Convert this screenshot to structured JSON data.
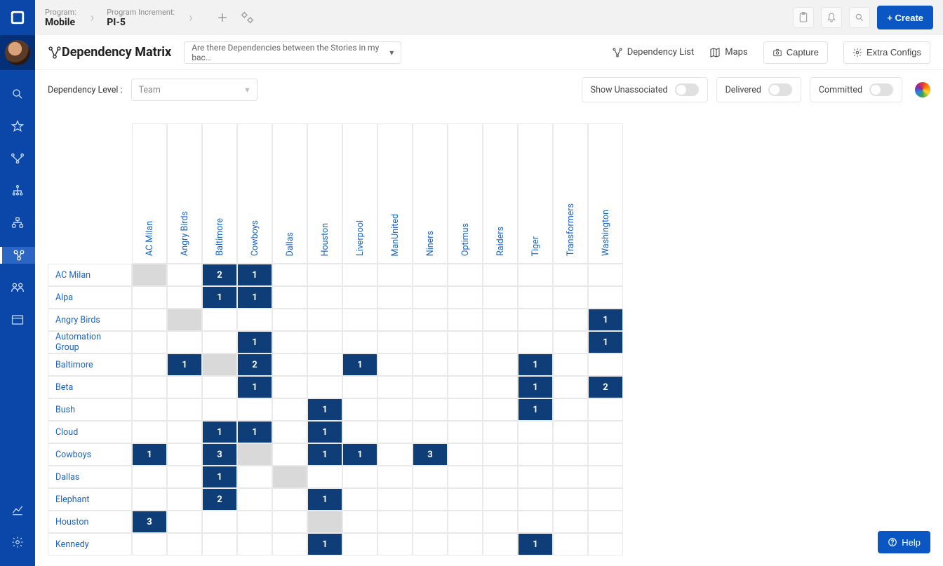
{
  "breadcrumb": {
    "program_label": "Program:",
    "program_value": "Mobile",
    "pi_label": "Program Increment:",
    "pi_value": "PI-5"
  },
  "topbar": {
    "create_label": "+ Create"
  },
  "page": {
    "title": "Dependency Matrix",
    "filter_label": "Are there Dependencies between the Stories in my bac…"
  },
  "views": {
    "dep_list": "Dependency List",
    "maps": "Maps",
    "capture": "Capture",
    "extra_configs": "Extra Configs"
  },
  "toolbar": {
    "level_label": "Dependency Level :",
    "level_value": "Team",
    "show_unassociated": "Show Unassociated",
    "delivered": "Delivered",
    "committed": "Committed"
  },
  "help": {
    "label": "Help"
  },
  "matrix": {
    "cols": [
      "AC Milan",
      "Angry Birds",
      "Baltimore",
      "Cowboys",
      "Dallas",
      "Houston",
      "Liverpool",
      "ManUnited",
      "Niners",
      "Optimus",
      "Raiders",
      "Tiger",
      "Transformers",
      "Washington"
    ],
    "rows": [
      {
        "name": "AC Milan",
        "diag": 0,
        "cells": {
          "2": 2,
          "3": 1
        }
      },
      {
        "name": "Alpa",
        "diag": -1,
        "cells": {
          "2": 1,
          "3": 1
        }
      },
      {
        "name": "Angry Birds",
        "diag": 1,
        "cells": {
          "13": 1
        }
      },
      {
        "name": "Automation Group",
        "diag": -1,
        "cells": {
          "3": 1,
          "13": 1
        }
      },
      {
        "name": "Baltimore",
        "diag": 2,
        "cells": {
          "1": 1,
          "3": 2,
          "6": 1,
          "11": 1
        }
      },
      {
        "name": "Beta",
        "diag": -1,
        "cells": {
          "3": 1,
          "11": 1,
          "13": 2
        }
      },
      {
        "name": "Bush",
        "diag": -1,
        "cells": {
          "5": 1,
          "11": 1
        }
      },
      {
        "name": "Cloud",
        "diag": -1,
        "cells": {
          "2": 1,
          "3": 1,
          "5": 1
        }
      },
      {
        "name": "Cowboys",
        "diag": 3,
        "cells": {
          "0": 1,
          "2": 3,
          "5": 1,
          "6": 1,
          "8": 3
        }
      },
      {
        "name": "Dallas",
        "diag": 4,
        "cells": {
          "2": 1
        }
      },
      {
        "name": "Elephant",
        "diag": -1,
        "cells": {
          "2": 2,
          "5": 1
        }
      },
      {
        "name": "Houston",
        "diag": 5,
        "cells": {
          "0": 3
        }
      },
      {
        "name": "Kennedy",
        "diag": -1,
        "cells": {
          "5": 1,
          "11": 1
        }
      }
    ]
  }
}
